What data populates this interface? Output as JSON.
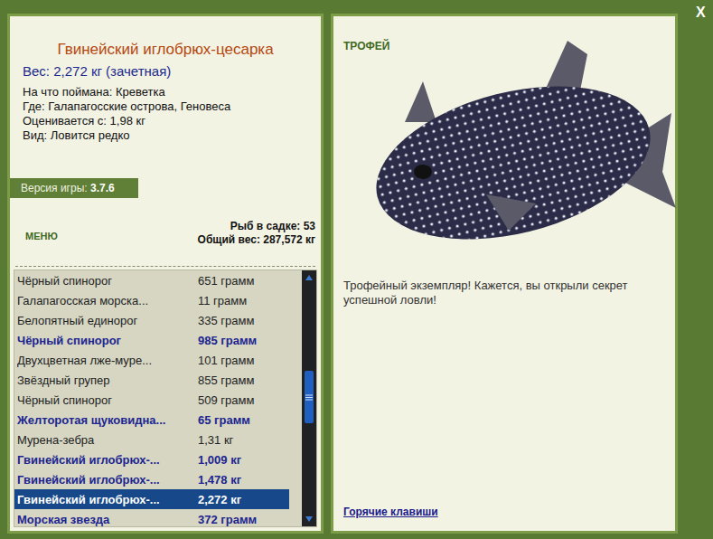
{
  "window": {
    "close": "X"
  },
  "catch": {
    "title": "Гвинейский иглобрюх-цесарка",
    "weight": "Вес: 2,272 кг (зачетная)",
    "details": [
      {
        "label": "На что поймана:",
        "value": "Креветка"
      },
      {
        "label": "Где:",
        "value": "Галапагосские острова, Геновеса"
      },
      {
        "label": "Оценивается с:",
        "value": "1,98 кг"
      },
      {
        "label": "Вид:",
        "value": "Ловится редко"
      }
    ]
  },
  "version": {
    "label": "Версия игры:",
    "value": "3.7.6"
  },
  "menu": "МЕНЮ",
  "keep_net": {
    "count_label": "Рыб в садке:",
    "count": "53",
    "weight_label": "Общий вес:",
    "weight": "287,572 кг"
  },
  "fish_list": [
    {
      "name": "Чёрный спинорог",
      "weight": "651 грамм",
      "counted": false,
      "selected": false
    },
    {
      "name": "Галапагосская морска...",
      "weight": "11 грамм",
      "counted": false,
      "selected": false
    },
    {
      "name": "Белопятный единорог",
      "weight": "335 грамм",
      "counted": false,
      "selected": false
    },
    {
      "name": "Чёрный спинорог",
      "weight": "985 грамм",
      "counted": true,
      "selected": false
    },
    {
      "name": "Двухцветная лже-муре...",
      "weight": "101 грамм",
      "counted": false,
      "selected": false
    },
    {
      "name": "Звёздный групер",
      "weight": "855 грамм",
      "counted": false,
      "selected": false
    },
    {
      "name": "Чёрный спинорог",
      "weight": "509 грамм",
      "counted": false,
      "selected": false
    },
    {
      "name": "Желторотая щуковидна...",
      "weight": "65 грамм",
      "counted": true,
      "selected": false
    },
    {
      "name": "Мурена-зебра",
      "weight": "1,31 кг",
      "counted": false,
      "selected": false
    },
    {
      "name": "Гвинейский иглобрюх-...",
      "weight": "1,009 кг",
      "counted": true,
      "selected": false
    },
    {
      "name": "Гвинейский иглобрюх-...",
      "weight": "1,478 кг",
      "counted": true,
      "selected": false
    },
    {
      "name": "Гвинейский иглобрюх-...",
      "weight": "2,272 кг",
      "counted": true,
      "selected": true
    },
    {
      "name": "Морская звезда",
      "weight": "372 грамм",
      "counted": true,
      "selected": false
    }
  ],
  "scrollbar": {
    "level": 0.38
  },
  "trophy": {
    "badge": "ТРОФЕЙ",
    "message": "Трофейный экземпляр! Кажется, вы открыли секрет успешной ловли!",
    "hotkeys": "Горячие клавиши"
  }
}
